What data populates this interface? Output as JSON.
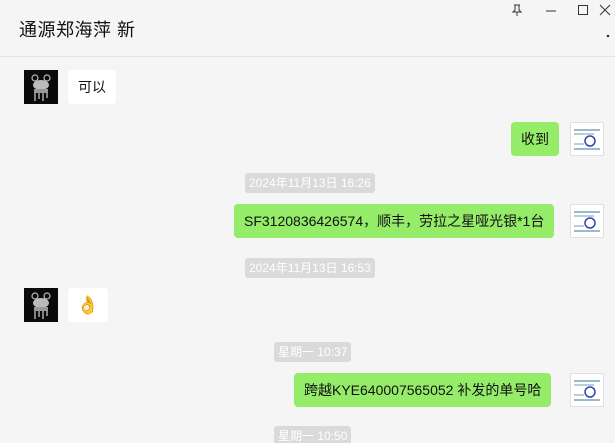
{
  "header": {
    "title": "通源郑海萍 新",
    "pin_icon": "pin-icon",
    "minimize_icon": "minimize-icon",
    "maximize_icon": "maximize-icon",
    "close_icon": "close-icon",
    "more_icon": "more-icon"
  },
  "messages": [
    {
      "side": "in",
      "type": "text",
      "text": "可以"
    },
    {
      "side": "out",
      "type": "text",
      "text": "收到"
    },
    {
      "type": "time",
      "text": "2024年11月13日 16:26"
    },
    {
      "side": "out",
      "type": "text",
      "text": "SF3120836426574，顺丰，劳拉之星哑光银*1台"
    },
    {
      "type": "time",
      "text": "2024年11月13日 16:53"
    },
    {
      "side": "in",
      "type": "emoji",
      "text": "👌"
    },
    {
      "type": "time",
      "text": "星期一 10:37"
    },
    {
      "side": "out",
      "type": "text",
      "text": "跨越KYE640007565052  补发的单号哈"
    },
    {
      "type": "time",
      "text": "星期一 10:50"
    }
  ],
  "colors": {
    "outgoing_bubble": "#95ec69",
    "incoming_bubble": "#ffffff",
    "background": "#f5f5f5",
    "time_badge": "#dadada"
  }
}
